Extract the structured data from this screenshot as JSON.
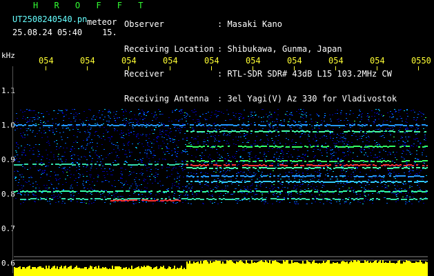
{
  "header": {
    "title": "H R O F F T",
    "filename": "UT2508240540.pn",
    "filename_suffix": "meteor",
    "datetime": "25.08.24 05:40",
    "interval": "15.",
    "info": [
      {
        "label": "Observer",
        "sep": ":",
        "value": "Masaki Kano"
      },
      {
        "label": "Receiving Location",
        "sep": ":",
        "value": "Shibukawa, Gunma, Japan"
      },
      {
        "label": "Receiver",
        "sep": ":",
        "value": "RTL-SDR SDR# 43dB L15 103.2MHz CW"
      },
      {
        "label": "Receiving Antenna",
        "sep": ":",
        "value": "3el Yagi(V) Az 330 for Vladivostok"
      }
    ]
  },
  "axes": {
    "y_unit": "kHz",
    "y_ticks": [
      "1.1",
      "1.0",
      "0.9",
      "0.8",
      "0.7",
      "0.6"
    ],
    "x_ticks": [
      "054",
      "054",
      "054",
      "054",
      "054",
      "054",
      "054",
      "054",
      "054",
      "0550"
    ]
  },
  "colors": {
    "background": "#000000",
    "title": "#33ff33",
    "filename": "#66ffff",
    "info_text": "#ffffff",
    "time_ticks": "#ffff33",
    "noise_low": "#0000aa",
    "noise_mid": "#0066ff",
    "signal_green": "#33ff66",
    "signal_red": "#ff3333",
    "power_bar": "#ffff00"
  }
}
